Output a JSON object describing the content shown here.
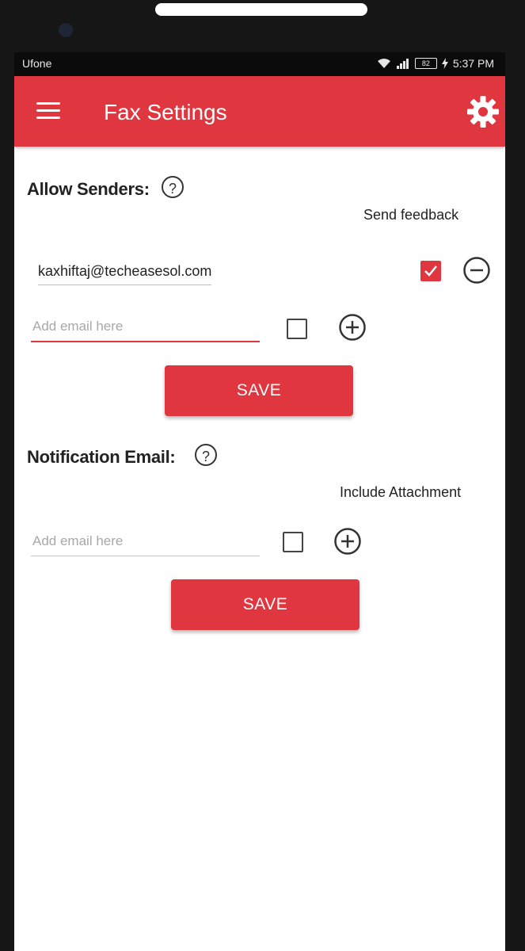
{
  "status_bar": {
    "carrier": "Ufone",
    "battery": "82",
    "time": "5:37 PM"
  },
  "app_bar": {
    "title": "Fax Settings",
    "menu_icon": "hamburger-menu-icon",
    "settings_icon": "gear-icon"
  },
  "allow_senders": {
    "label": "Allow Senders:",
    "help_glyph": "?",
    "column_header": "Send feedback",
    "entries": [
      {
        "email": "kaxhiftaj@techeasesol.com",
        "send_feedback": true,
        "action_icon": "remove-circle-icon"
      }
    ],
    "new_entry": {
      "value": "",
      "placeholder": "Add email here",
      "send_feedback": false,
      "action_icon": "add-circle-icon"
    },
    "save_label": "SAVE"
  },
  "notification_email": {
    "label": "Notification Email:",
    "help_glyph": "?",
    "column_header": "Include Attachment",
    "new_entry": {
      "value": "",
      "placeholder": "Add email here",
      "include_attachment": false,
      "action_icon": "add-circle-icon"
    },
    "save_label": "SAVE"
  },
  "colors": {
    "accent": "#e0363f",
    "status_bar": "#0b0b0b",
    "device_frame": "#161616"
  }
}
